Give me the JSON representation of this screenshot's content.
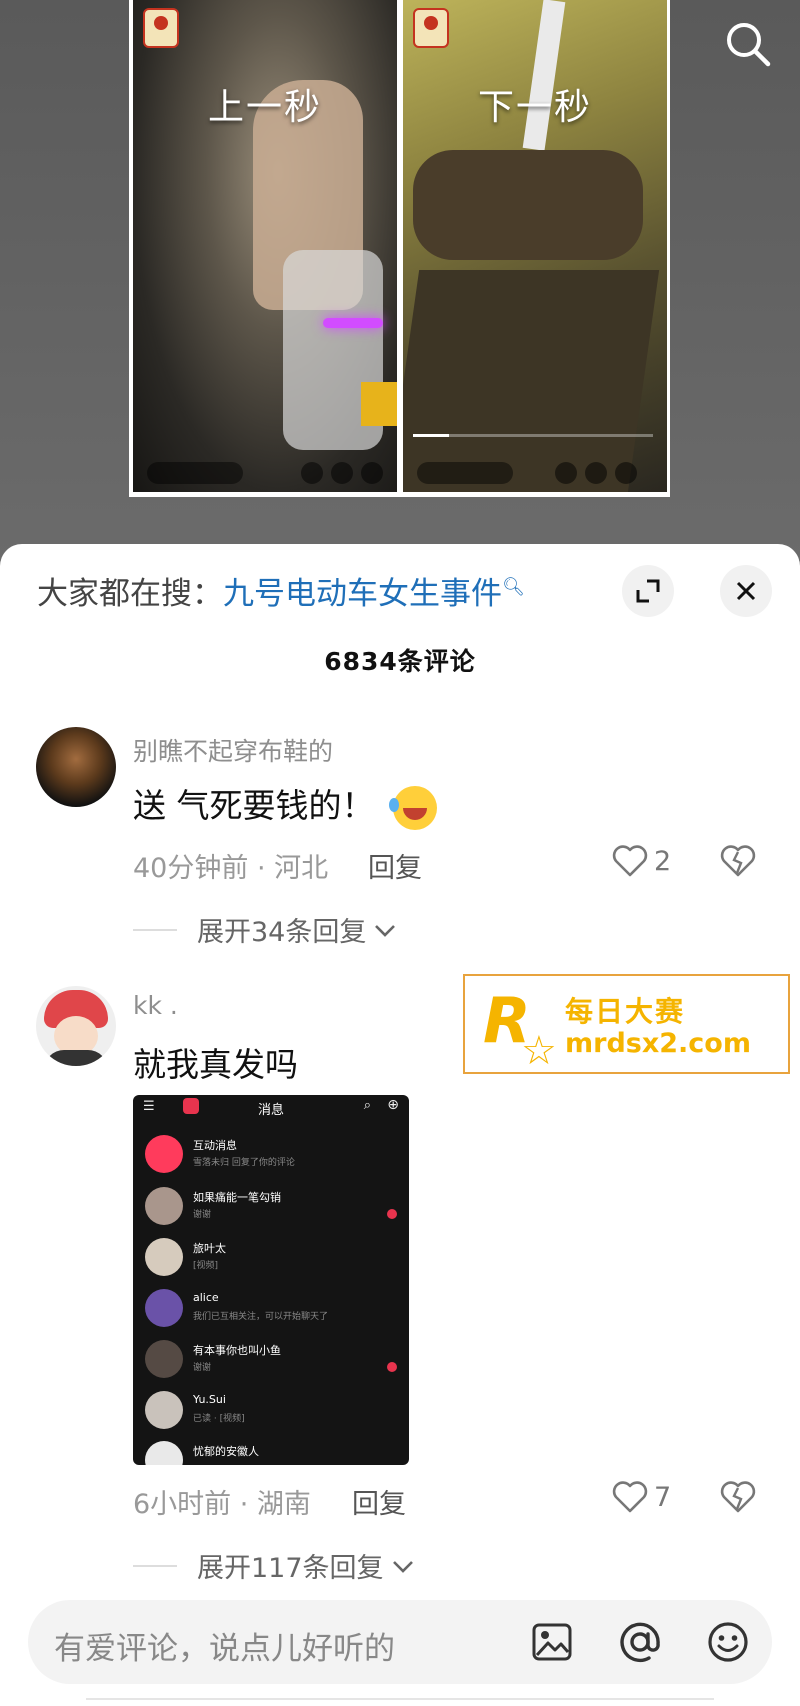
{
  "video": {
    "left_caption": "上一秒",
    "right_caption": "下一秒",
    "progress": 0.15
  },
  "panel": {
    "hot_search_prefix": "大家都在搜：",
    "hot_search_term": "九号电动车女生事件",
    "comment_count": "6834条评论"
  },
  "comments": [
    {
      "username": "别瞧不起穿布鞋的",
      "text": "送 气死要钱的！",
      "time_location": "40分钟前 · 河北",
      "reply_label": "回复",
      "likes": "2",
      "expand_label": "展开34条回复"
    },
    {
      "username": "kk .",
      "text": "就我真发吗",
      "time_location": "6小时前 · 湖南",
      "reply_label": "回复",
      "likes": "7",
      "expand_label": "展开117条回复"
    }
  ],
  "attached_image": {
    "title": "消息",
    "rows": [
      {
        "name": "互动消息",
        "sub": "雪落未归 回复了你的评论"
      },
      {
        "name": "如果痛能一笔勾销",
        "sub": "谢谢"
      },
      {
        "name": "旅叶太",
        "sub": "[视频]"
      },
      {
        "name": "alice",
        "sub": "我们已互相关注，可以开始聊天了"
      },
      {
        "name": "有本事你也叫小鱼",
        "sub": "谢谢"
      },
      {
        "name": "Yu.Sui",
        "sub": "已读 · [视频]"
      },
      {
        "name": "忧郁的安徽人",
        "sub": ""
      }
    ]
  },
  "watermark": {
    "logo_letter": "R",
    "cn": "每日大赛",
    "url": "mrdsx2.com"
  },
  "input": {
    "placeholder": "有爱评论，说点儿好听的"
  },
  "colors": {
    "accent_link": "#1f6fb8",
    "watermark": "#f5b400",
    "sheet_bg": "#ffffff"
  }
}
